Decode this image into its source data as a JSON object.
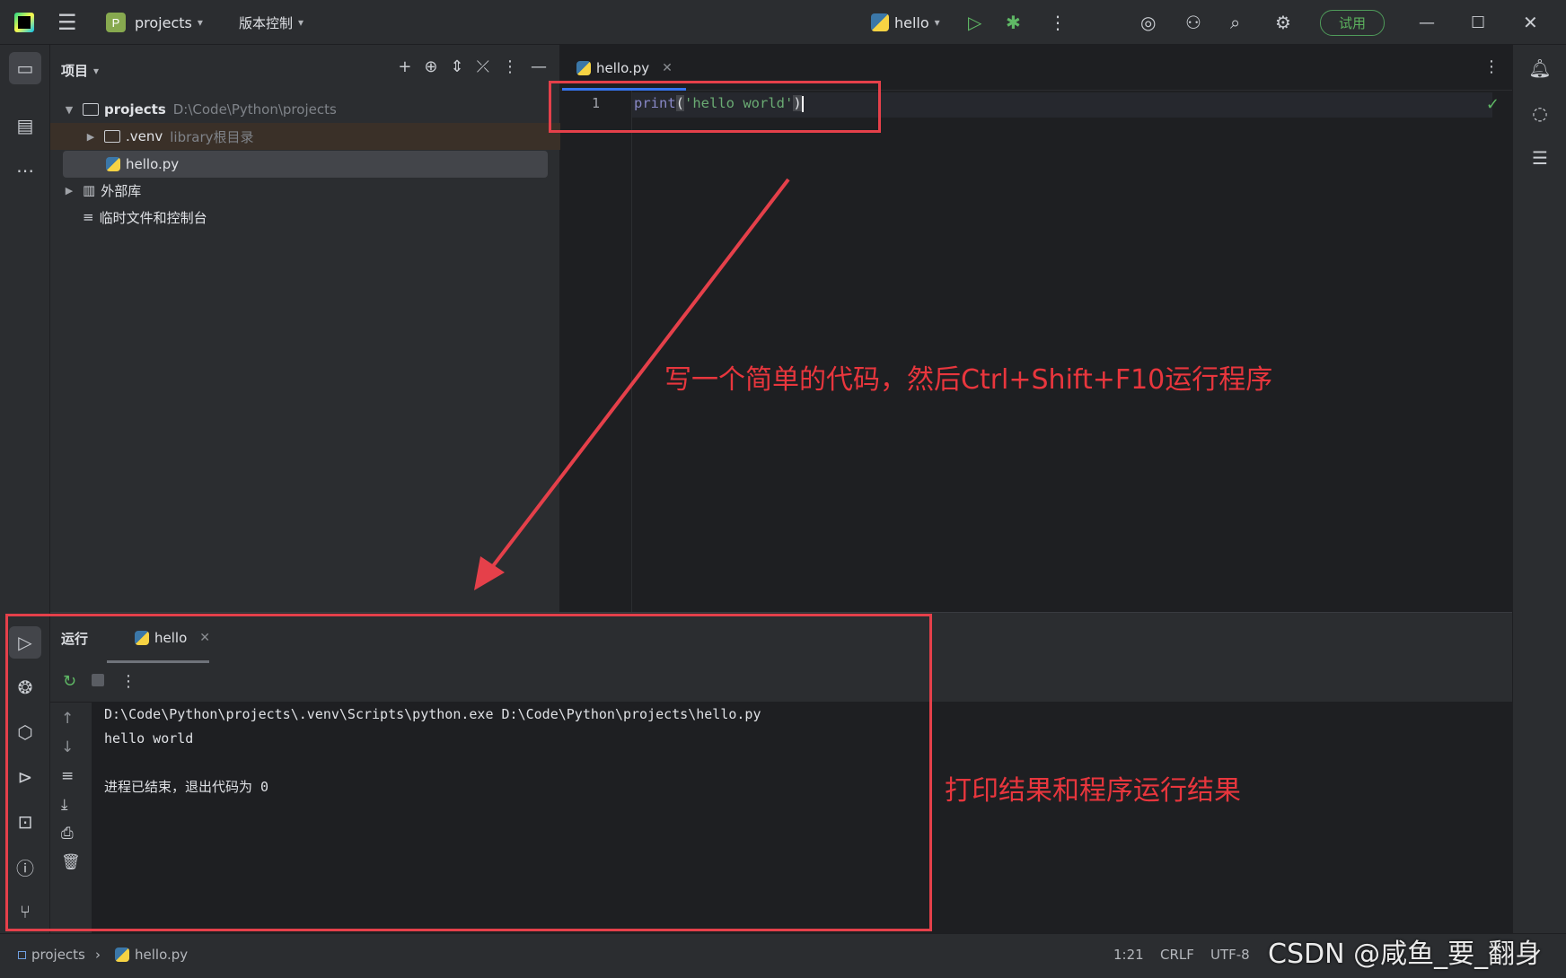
{
  "titlebar": {
    "project_name": "projects",
    "vcs_menu": "版本控制",
    "run_config": "hello",
    "trial_button": "试用",
    "project_badge": "P"
  },
  "project_panel": {
    "title": "项目",
    "tree": {
      "root_name": "projects",
      "root_path": "D:\\Code\\Python\\projects",
      "venv_name": ".venv",
      "venv_hint": "library根目录",
      "file_name": "hello.py",
      "external_libs": "外部库",
      "scratches": "临时文件和控制台"
    }
  },
  "editor": {
    "tab_label": "hello.py",
    "line_number": "1",
    "code_func": "print",
    "code_open": "(",
    "code_string": "'hello world'",
    "code_close": ")"
  },
  "run_panel": {
    "title": "运行",
    "tab_label": "hello",
    "console": {
      "line1": "D:\\Code\\Python\\projects\\.venv\\Scripts\\python.exe D:\\Code\\Python\\projects\\hello.py",
      "line2": "hello world",
      "line3": "",
      "line4": "进程已结束，退出代码为 0"
    }
  },
  "statusbar": {
    "crumb_project": "projects",
    "crumb_file": "hello.py",
    "position": "1:21",
    "line_sep": "CRLF",
    "encoding": "UTF-8"
  },
  "annotations": {
    "editor_note": "写一个简单的代码，然后Ctrl+Shift+F10运行程序",
    "run_note": "打印结果和程序运行结果",
    "watermark": "CSDN @咸鱼_要_翻身"
  },
  "colors": {
    "annotation": "#e5404a",
    "background": "#1e1f22",
    "panel": "#2b2d30",
    "accent": "#3574f0"
  }
}
